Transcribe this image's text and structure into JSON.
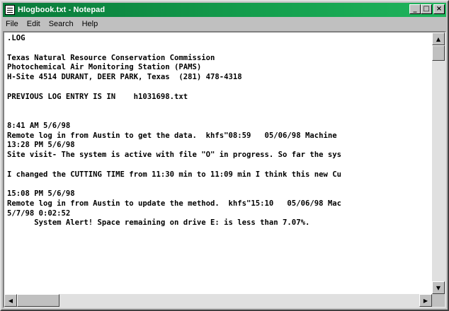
{
  "window": {
    "title": "Hlogbook.txt - Notepad",
    "controls": {
      "minimize": "_",
      "maximize": "□",
      "close": "×"
    }
  },
  "menu": [
    "File",
    "Edit",
    "Search",
    "Help"
  ],
  "document": {
    "lines": [
      ".LOG",
      "",
      "Texas Natural Resource Conservation Commission",
      "Photochemical Air Monitoring Station (PAMS)",
      "H-Site 4514 DURANT, DEER PARK, Texas  (281) 478-4318",
      "",
      "PREVIOUS LOG ENTRY IS IN    h1031698.txt",
      "",
      "",
      "8:41 AM 5/6/98",
      "Remote log in from Austin to get the data.  khfs\"08:59   05/06/98 Machine",
      "13:28 PM 5/6/98",
      "Site visit- The system is active with file \"O\" in progress. So far the sys",
      "",
      "I changed the CUTTING TIME from 11:30 min to 11:09 min I think this new Cu",
      "",
      "15:08 PM 5/6/98",
      "Remote log in from Austin to update the method.  khfs\"15:10   05/06/98 Mac",
      "5/7/98 0:02:52",
      "      System Alert! Space remaining on drive E: is less than 7.07%."
    ]
  },
  "scrollbar": {
    "up_arrow": "▲",
    "down_arrow": "▼",
    "left_arrow": "◀",
    "right_arrow": "▶",
    "vertical_position": 0.0,
    "horizontal_position": 0.0
  }
}
